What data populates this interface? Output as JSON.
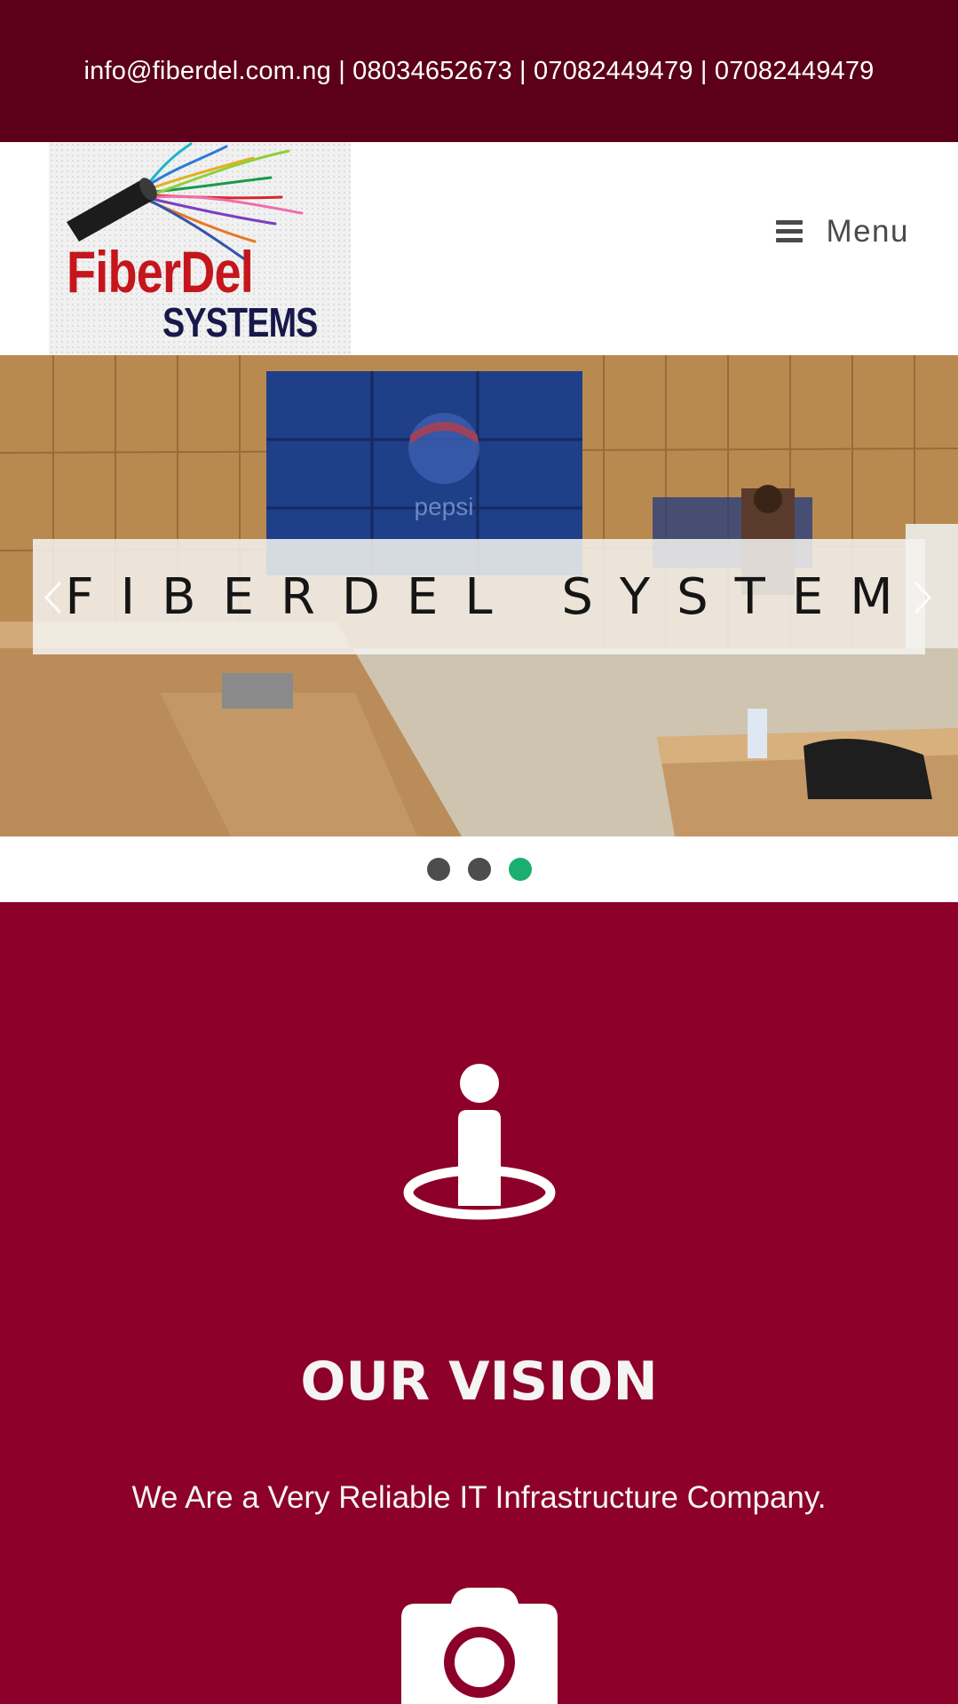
{
  "topbar": {
    "contact": "info@fiberdel.com.ng | 08034652673 | 07082449479 | 07082449479"
  },
  "header": {
    "logo": {
      "line1": "FiberDel",
      "line2": "SYSTEMS"
    },
    "menu_label": "Menu",
    "menu_icon": "hamburger-icon"
  },
  "slider": {
    "caption": "FIBERDEL SYSTEM",
    "prev_icon": "chevron-left-icon",
    "next_icon": "chevron-right-icon",
    "slide_count": 3,
    "active_slide": 3
  },
  "vision": {
    "icon": "person-standing-icon",
    "title": "OUR VISION",
    "text": "We Are a Very Reliable IT Infrastructure Company.",
    "next_icon": "camera-icon"
  },
  "colors": {
    "topbar_bg": "#5b0018",
    "section_bg": "#8c0029",
    "dot_active": "#1aae6f",
    "dot_inactive": "#4d4d4d",
    "logo_red": "#c4161c",
    "logo_navy": "#18184a"
  }
}
